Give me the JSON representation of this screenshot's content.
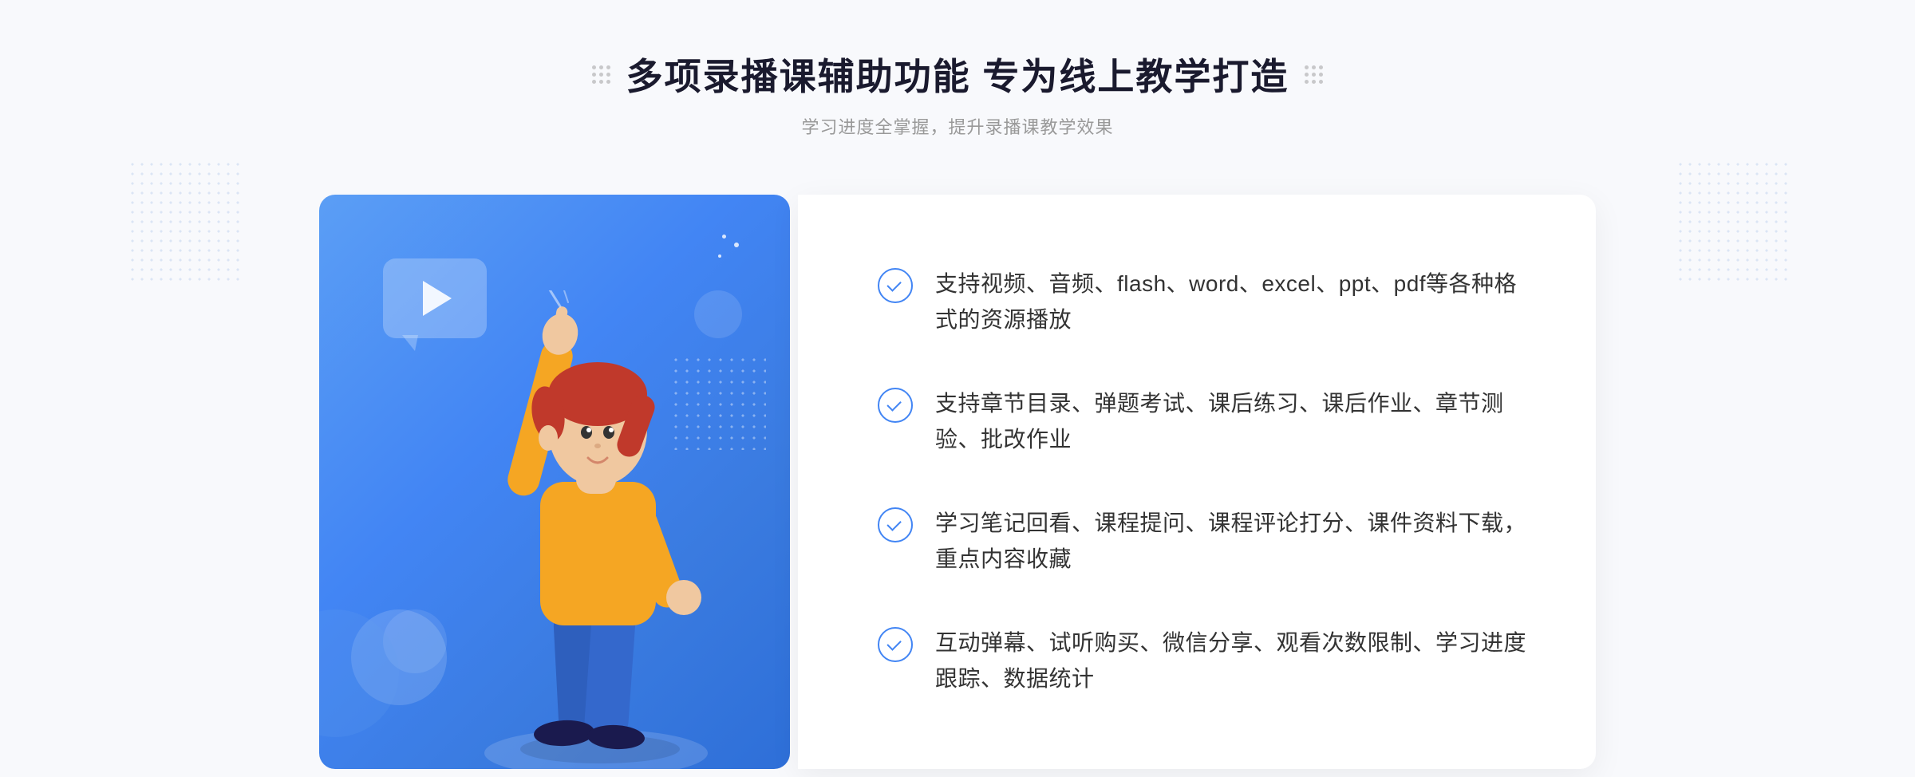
{
  "header": {
    "title": "多项录播课辅助功能 专为线上教学打造",
    "subtitle": "学习进度全掌握，提升录播课教学效果"
  },
  "features": [
    {
      "id": "feature-1",
      "text": "支持视频、音频、flash、word、excel、ppt、pdf等各种格式的资源播放"
    },
    {
      "id": "feature-2",
      "text": "支持章节目录、弹题考试、课后练习、课后作业、章节测验、批改作业"
    },
    {
      "id": "feature-3",
      "text": "学习笔记回看、课程提问、课程评论打分、课件资料下载，重点内容收藏"
    },
    {
      "id": "feature-4",
      "text": "互动弹幕、试听购买、微信分享、观看次数限制、学习进度跟踪、数据统计"
    }
  ],
  "decorative": {
    "chevrons": "»"
  }
}
